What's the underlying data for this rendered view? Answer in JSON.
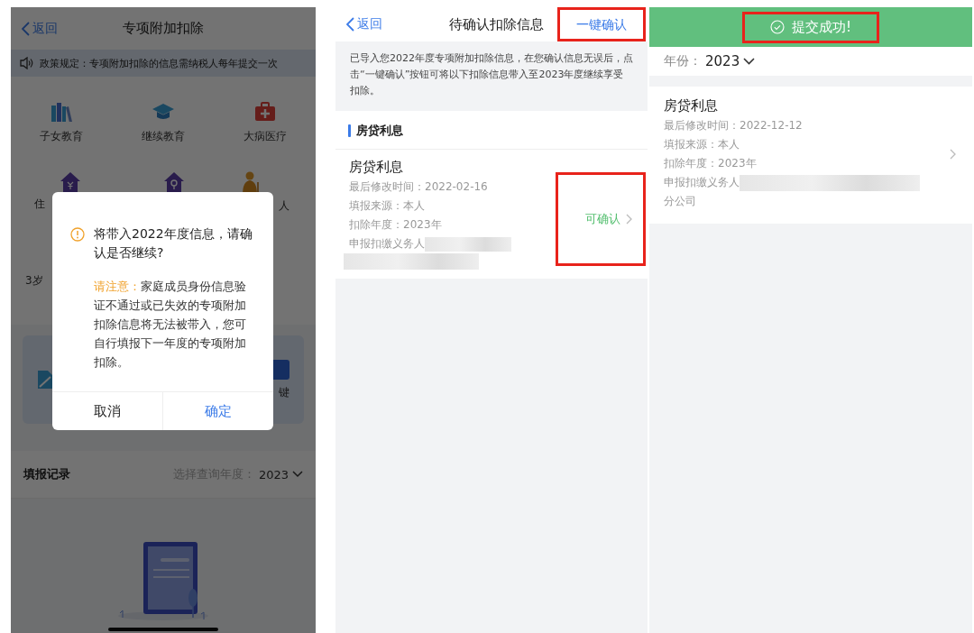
{
  "screen_1": {
    "nav": {
      "back": "返回",
      "title": "专项附加扣除"
    },
    "notice": "政策规定：专项附加扣除的信息需纳税人每年提交一次",
    "categories": [
      {
        "label": "子女教育"
      },
      {
        "label": "继续教育"
      },
      {
        "label": "大病医疗"
      }
    ],
    "categories_row_2": [
      {
        "label": "住"
      },
      {
        "label": "人"
      }
    ],
    "hint_fragment": "3岁",
    "card_fragment": "键",
    "dialog": {
      "title": "将带入2022年度信息，请确认是否继续?",
      "note_label": "请注意：",
      "note": "家庭成员身份信息验证不通过或已失效的专项附加扣除信息将无法被带入，您可自行填报下一年度的专项附加扣除。",
      "buttons": [
        {
          "label": "取消",
          "kind": "cancel"
        },
        {
          "label": "确定",
          "kind": "confirm"
        }
      ]
    },
    "records": {
      "title": "填报记录",
      "year_label": "选择查询年度：",
      "year": "2023"
    }
  },
  "screen_2": {
    "nav": {
      "back": "返回",
      "title": "待确认扣除信息",
      "action": "一键确认",
      "highlighted": true
    },
    "info": "已导入您2022年度专项附加扣除信息，在您确认信息无误后，点击“一键确认”按钮可将以下扣除信息带入至2023年度继续享受扣除。",
    "section": "房贷利息",
    "items": [
      {
        "title": "房贷利息",
        "lines": [
          "最后修改时间：2022-02-16",
          "填报来源：本人",
          "扣除年度：2023年",
          "申报扣缴义务人"
        ],
        "status": "可确认",
        "highlighted": true
      }
    ]
  },
  "screen_3": {
    "toast": {
      "text": "提交成功!",
      "highlighted": true
    },
    "year_label": "年份：",
    "year": "2023",
    "items": [
      {
        "title": "房贷利息",
        "lines": [
          "最后修改时间：2022-12-12",
          "填报来源：本人",
          "扣除年度：2023年",
          "申报扣缴义务人"
        ],
        "tail": "分公司"
      }
    ]
  }
}
